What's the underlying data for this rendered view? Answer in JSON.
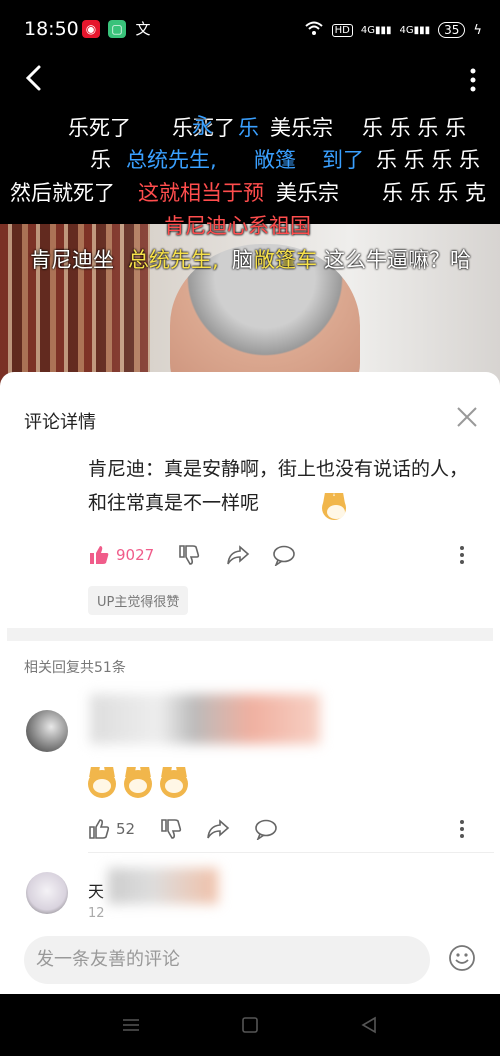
{
  "status_bar": {
    "time": "18:50",
    "hd": "HD",
    "net1": "4G",
    "net2": "4G",
    "battery": "35"
  },
  "video": {
    "danmaku": [
      {
        "text": "乐死了",
        "color": "white"
      },
      {
        "text": "乐死了",
        "color": "white"
      },
      {
        "text": "永",
        "color": "blue"
      },
      {
        "text": "乐",
        "color": "blue"
      },
      {
        "text": "美乐宗",
        "color": "white"
      },
      {
        "text": "乐   乐 乐 乐",
        "color": "white"
      },
      {
        "text": "乐",
        "color": "white"
      },
      {
        "text": "总统先生,",
        "color": "blue"
      },
      {
        "text": "敞篷",
        "color": "blue"
      },
      {
        "text": "到了",
        "color": "blue"
      },
      {
        "text": "乐   乐 乐 乐",
        "color": "white"
      },
      {
        "text": "然后就死了",
        "color": "white"
      },
      {
        "text": "这就相当于预",
        "color": "red"
      },
      {
        "text": "美乐宗",
        "color": "white"
      },
      {
        "text": "乐   乐 乐 克",
        "color": "white"
      },
      {
        "text": "肯尼迪坐",
        "color": "white"
      },
      {
        "text": "总统先生,",
        "color": "yellow"
      },
      {
        "text": "脑",
        "color": "white"
      },
      {
        "text": "敞篷车",
        "color": "yellow"
      },
      {
        "text": "这么牛逼嘛？哈",
        "color": "white"
      },
      {
        "text": "肯尼迪心系祖国",
        "color": "red"
      }
    ]
  },
  "sheet": {
    "title": "评论详情",
    "comment_text": "肯尼迪：真是安静啊，街上也没有说话的人，和往常真是不一样呢",
    "like_count": "9027",
    "up_badge": "UP主觉得很赞",
    "reply_count_label": "相关回复共51条",
    "reply1": {
      "emoji_count": 3,
      "like_count": "52"
    },
    "reply2": {
      "name": "天",
      "meta": "12"
    },
    "input_placeholder": "发一条友善的评论"
  },
  "colors": {
    "liked_pink": "#f05c8a",
    "danmaku_yellow": "#f7e14a",
    "danmaku_blue": "#3aa0ff",
    "danmaku_red": "#ff4d4d"
  },
  "icons": [
    "back-icon",
    "more-icon",
    "close-icon",
    "like-icon",
    "dislike-icon",
    "share-icon",
    "comment-icon",
    "emoji-icon",
    "menu-icon",
    "home-icon",
    "back-nav-icon"
  ]
}
